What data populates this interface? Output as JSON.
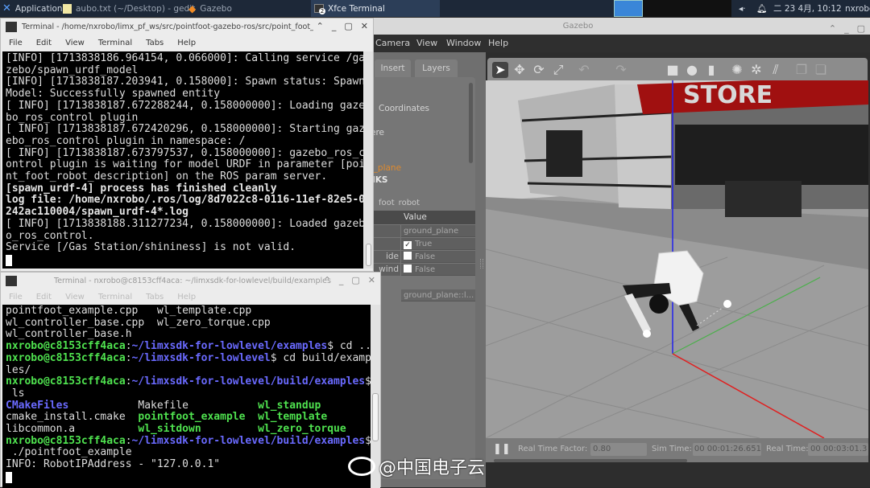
{
  "taskbar": {
    "applications": "Applications",
    "windows": [
      {
        "label": "aubo.txt (~/Desktop) - gedit",
        "icon": "gedit-icon"
      },
      {
        "label": "Gazebo",
        "icon": "gazebo-icon"
      },
      {
        "label": "Xfce Terminal",
        "icon": "terminal-icon",
        "badge": "2",
        "active": true
      }
    ],
    "clock": "二 23 4月, 10:12",
    "user": "nxrobo"
  },
  "gazebo": {
    "title": "Gazebo",
    "menu": [
      "Camera",
      "View",
      "Window",
      "Help"
    ],
    "tabs": [
      "Insert",
      "Layers"
    ],
    "tree": {
      "coordinates": "Coordinates",
      "item_ere": "ere",
      "ground_plane": "d_plane",
      "links": "NKS",
      "item_k": "k",
      "robot": "foot_robot"
    },
    "properties": {
      "value_header": "Value",
      "rows": [
        {
          "label": "",
          "value": "ground_plane"
        },
        {
          "label": "",
          "value": "True",
          "checked": true
        },
        {
          "label": "ide",
          "value": "False",
          "checked": false
        },
        {
          "label": "wind",
          "value": "False",
          "checked": false
        }
      ],
      "link_value": "ground_plane::l..."
    },
    "scene": {
      "sign_text": "STORE"
    },
    "bottom": {
      "rtf_label": "Real Time Factor:",
      "rtf_value": "0.80",
      "sim_label": "Sim Time:",
      "sim_value": "00 00:01:26.651",
      "real_label": "Real Time:",
      "real_value": "00 00:03:01.3"
    },
    "accent": "#e08a2c"
  },
  "terminal1": {
    "title": "Terminal - /home/nxrobo/limx_pf_ws/src/pointfoot-gazebo-ros/src/point_foot_robot_desc",
    "menu": [
      "File",
      "Edit",
      "View",
      "Terminal",
      "Tabs",
      "Help"
    ],
    "lines": [
      [
        {
          "t": "[INFO] [1713838186.964154, 0.066000]: Calling service /ga"
        }
      ],
      [
        {
          "t": "zebo/spawn_urdf_model"
        }
      ],
      [
        {
          "t": "[INFO] [1713838187.203941, 0.158000]: Spawn status: Spawn"
        }
      ],
      [
        {
          "t": "Model: Successfully spawned entity"
        }
      ],
      [
        {
          "t": "[ INFO] [1713838187.672288244, 0.158000000]: Loading gaze"
        }
      ],
      [
        {
          "t": "bo_ros_control plugin"
        }
      ],
      [
        {
          "t": "[ INFO] [1713838187.672420296, 0.158000000]: Starting gaz"
        }
      ],
      [
        {
          "t": "ebo_ros_control plugin in namespace: /"
        }
      ],
      [
        {
          "t": "[ INFO] [1713838187.673797537, 0.158000000]: gazebo_ros_c"
        }
      ],
      [
        {
          "t": "ontrol plugin is waiting for model URDF in parameter [poi"
        }
      ],
      [
        {
          "t": "nt_foot_robot_description] on the ROS param server."
        }
      ],
      [
        {
          "t": "[spawn_urdf-4] process has finished cleanly",
          "c": "w"
        }
      ],
      [
        {
          "t": "log file: /home/nxrobo/.ros/log/8d7022c8-0116-11ef-82e5-0",
          "c": "w"
        }
      ],
      [
        {
          "t": "242ac110004/spawn_urdf-4*.log",
          "c": "w"
        }
      ],
      [
        {
          "t": "[ INFO] [1713838188.311277234, 0.158000000]: Loaded gazeb"
        }
      ],
      [
        {
          "t": "o_ros_control."
        }
      ],
      [
        {
          "t": "Service [/Gas Station/shininess] is not valid."
        }
      ]
    ]
  },
  "terminal2": {
    "title": "Terminal - nxrobo@c8153cff4aca: ~/limxsdk-for-lowlevel/build/examples",
    "menu": [
      "File",
      "Edit",
      "View",
      "Terminal",
      "Tabs",
      "Help"
    ],
    "lines": [
      [
        {
          "t": "pointfoot_example.cpp   wl_template.cpp"
        }
      ],
      [
        {
          "t": "wl_controller_base.cpp  wl_zero_torque.cpp"
        }
      ],
      [
        {
          "t": "wl_controller_base.h"
        }
      ],
      [
        {
          "t": "nxrobo@c8153cff4aca",
          "c": "g"
        },
        {
          "t": ":"
        },
        {
          "t": "~/limxsdk-for-lowlevel/examples",
          "c": "b"
        },
        {
          "t": "$ cd .."
        }
      ],
      [
        {
          "t": "nxrobo@c8153cff4aca",
          "c": "g"
        },
        {
          "t": ":"
        },
        {
          "t": "~/limxsdk-for-lowlevel",
          "c": "b"
        },
        {
          "t": "$ cd build/examp"
        }
      ],
      [
        {
          "t": "les/"
        }
      ],
      [
        {
          "t": "nxrobo@c8153cff4aca",
          "c": "g"
        },
        {
          "t": ":"
        },
        {
          "t": "~/limxsdk-for-lowlevel/build/examples",
          "c": "b"
        },
        {
          "t": "$"
        }
      ],
      [
        {
          "t": " ls"
        }
      ],
      [
        {
          "t": "CMakeFiles",
          "c": "b"
        },
        {
          "t": "           Makefile           "
        },
        {
          "t": "wl_standup",
          "c": "g"
        }
      ],
      [
        {
          "t": "cmake_install.cmake  "
        },
        {
          "t": "pointfoot_example",
          "c": "g"
        },
        {
          "t": "  "
        },
        {
          "t": "wl_template",
          "c": "g"
        }
      ],
      [
        {
          "t": "libcommon.a          "
        },
        {
          "t": "wl_sitdown",
          "c": "g"
        },
        {
          "t": "         "
        },
        {
          "t": "wl_zero_torque",
          "c": "g"
        }
      ],
      [
        {
          "t": "nxrobo@c8153cff4aca",
          "c": "g"
        },
        {
          "t": ":"
        },
        {
          "t": "~/limxsdk-for-lowlevel/build/examples",
          "c": "b"
        },
        {
          "t": "$"
        }
      ],
      [
        {
          "t": " ./pointfoot_example"
        }
      ],
      [
        {
          "t": "INFO: RobotIPAddress - \"127.0.0.1\""
        }
      ]
    ]
  },
  "watermark": "@中国电子云"
}
